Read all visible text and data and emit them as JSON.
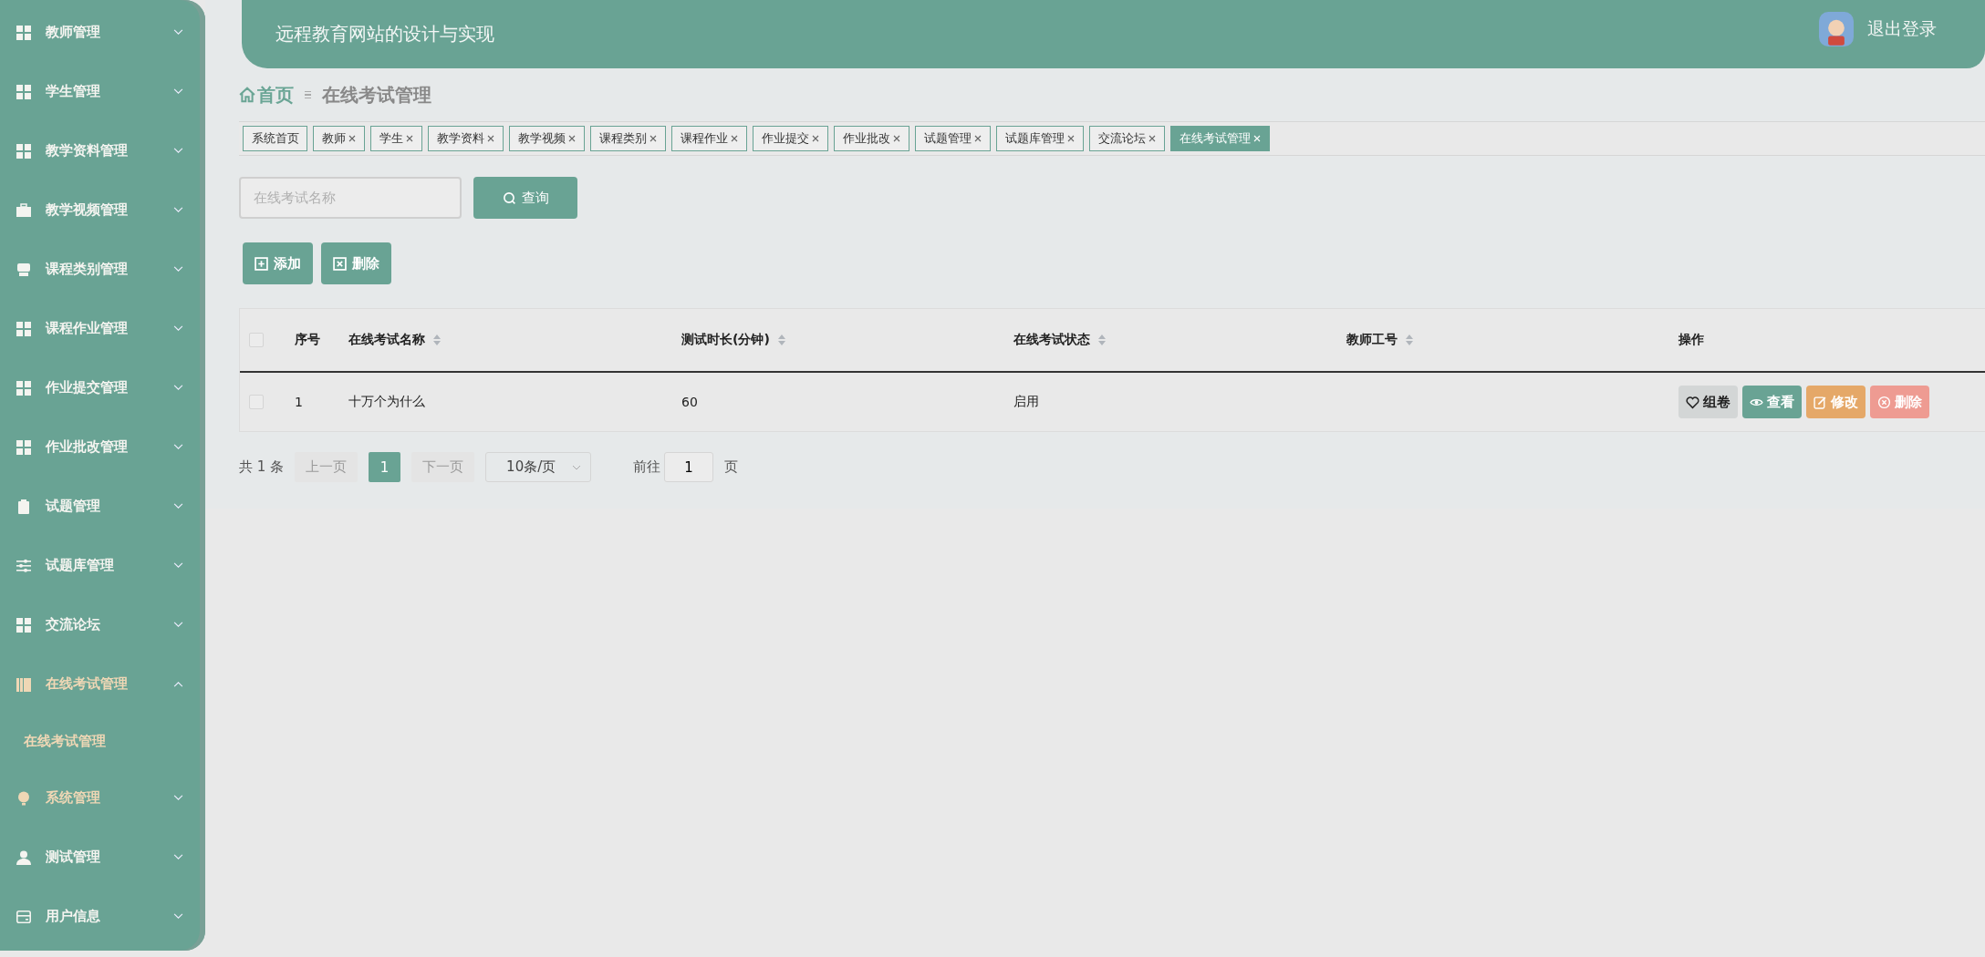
{
  "sidebar": {
    "items": [
      {
        "label": "教师管理",
        "expanded": false,
        "highlighted": false
      },
      {
        "label": "学生管理",
        "expanded": false,
        "highlighted": false
      },
      {
        "label": "教学资料管理",
        "expanded": false,
        "highlighted": false
      },
      {
        "label": "教学视频管理",
        "expanded": false,
        "highlighted": false
      },
      {
        "label": "课程类别管理",
        "expanded": false,
        "highlighted": false
      },
      {
        "label": "课程作业管理",
        "expanded": false,
        "highlighted": false
      },
      {
        "label": "作业提交管理",
        "expanded": false,
        "highlighted": false
      },
      {
        "label": "作业批改管理",
        "expanded": false,
        "highlighted": false
      },
      {
        "label": "试题管理",
        "expanded": false,
        "highlighted": false
      },
      {
        "label": "试题库管理",
        "expanded": false,
        "highlighted": false
      },
      {
        "label": "交流论坛",
        "expanded": false,
        "highlighted": false
      },
      {
        "label": "在线考试管理",
        "expanded": true,
        "highlighted": true,
        "children": [
          {
            "label": "在线考试管理",
            "highlighted": true
          }
        ]
      },
      {
        "label": "系统管理",
        "expanded": false,
        "highlighted": true
      },
      {
        "label": "测试管理",
        "expanded": false,
        "highlighted": false
      },
      {
        "label": "用户信息",
        "expanded": false,
        "highlighted": false
      }
    ]
  },
  "header": {
    "title": "远程教育网站的设计与实现",
    "logout": "退出登录"
  },
  "breadcrumb": [
    "首页",
    "在线考试管理"
  ],
  "tabs": [
    {
      "label": "系统首页",
      "closable": false,
      "selected": false
    },
    {
      "label": "教师",
      "closable": true,
      "selected": false
    },
    {
      "label": "学生",
      "closable": true,
      "selected": false
    },
    {
      "label": "教学资料",
      "closable": true,
      "selected": false
    },
    {
      "label": "教学视频",
      "closable": true,
      "selected": false
    },
    {
      "label": "课程类别",
      "closable": true,
      "selected": false
    },
    {
      "label": "课程作业",
      "closable": true,
      "selected": false
    },
    {
      "label": "作业提交",
      "closable": true,
      "selected": false
    },
    {
      "label": "作业批改",
      "closable": true,
      "selected": false
    },
    {
      "label": "试题管理",
      "closable": true,
      "selected": false
    },
    {
      "label": "试题库管理",
      "closable": true,
      "selected": false
    },
    {
      "label": "交流论坛",
      "closable": true,
      "selected": false
    },
    {
      "label": "在线考试管理",
      "closable": true,
      "selected": true
    }
  ],
  "search": {
    "placeholder": "在线考试名称",
    "button": "查询"
  },
  "actions": [
    "添加",
    "删除"
  ],
  "table": {
    "header_checked": false,
    "columns": [
      {
        "label": "序号",
        "sortable": false
      },
      {
        "label": "在线考试名称",
        "sortable": true
      },
      {
        "label": "测试时长(分钟)",
        "sortable": true
      },
      {
        "label": "在线考试状态",
        "sortable": true
      },
      {
        "label": "教师工号",
        "sortable": true
      },
      {
        "label": "操作",
        "sortable": false
      }
    ],
    "rows": [
      {
        "checked": false,
        "cells": [
          "1",
          "十万个为什么",
          "60",
          "启用",
          ""
        ],
        "buttons": [
          {
            "label": "组卷",
            "kind": "neutral"
          },
          {
            "label": "查看",
            "kind": "primary"
          },
          {
            "label": "修改",
            "kind": "warning"
          },
          {
            "label": "删除",
            "kind": "danger"
          }
        ]
      }
    ]
  },
  "pagination": {
    "total": "共 1 条",
    "prev": "上一页",
    "pages": [
      {
        "label": "1",
        "selected": true
      }
    ],
    "next": "下一页",
    "prev_disabled": true,
    "next_disabled": true,
    "page_size": "10条/页",
    "goto": "前往",
    "goto_value": "1",
    "page_unit": "页"
  }
}
